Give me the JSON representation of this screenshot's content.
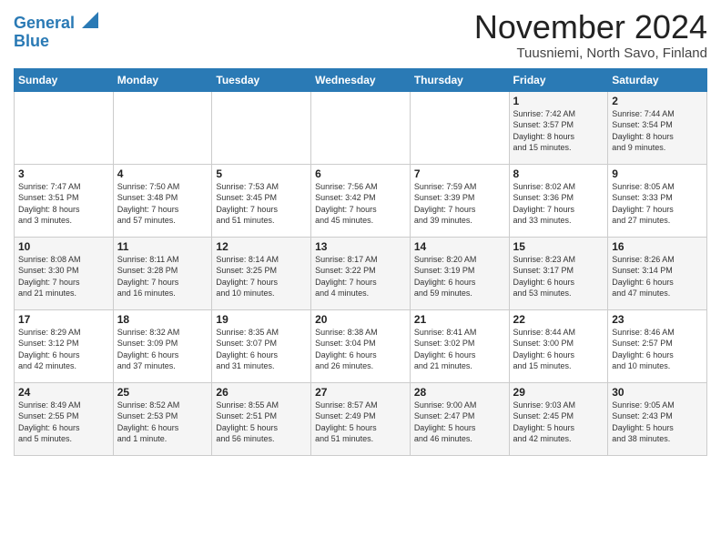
{
  "header": {
    "logo_line1": "General",
    "logo_line2": "Blue",
    "title": "November 2024",
    "subtitle": "Tuusniemi, North Savo, Finland"
  },
  "days_of_week": [
    "Sunday",
    "Monday",
    "Tuesday",
    "Wednesday",
    "Thursday",
    "Friday",
    "Saturday"
  ],
  "weeks": [
    [
      {
        "day": "",
        "info": ""
      },
      {
        "day": "",
        "info": ""
      },
      {
        "day": "",
        "info": ""
      },
      {
        "day": "",
        "info": ""
      },
      {
        "day": "",
        "info": ""
      },
      {
        "day": "1",
        "info": "Sunrise: 7:42 AM\nSunset: 3:57 PM\nDaylight: 8 hours\nand 15 minutes."
      },
      {
        "day": "2",
        "info": "Sunrise: 7:44 AM\nSunset: 3:54 PM\nDaylight: 8 hours\nand 9 minutes."
      }
    ],
    [
      {
        "day": "3",
        "info": "Sunrise: 7:47 AM\nSunset: 3:51 PM\nDaylight: 8 hours\nand 3 minutes."
      },
      {
        "day": "4",
        "info": "Sunrise: 7:50 AM\nSunset: 3:48 PM\nDaylight: 7 hours\nand 57 minutes."
      },
      {
        "day": "5",
        "info": "Sunrise: 7:53 AM\nSunset: 3:45 PM\nDaylight: 7 hours\nand 51 minutes."
      },
      {
        "day": "6",
        "info": "Sunrise: 7:56 AM\nSunset: 3:42 PM\nDaylight: 7 hours\nand 45 minutes."
      },
      {
        "day": "7",
        "info": "Sunrise: 7:59 AM\nSunset: 3:39 PM\nDaylight: 7 hours\nand 39 minutes."
      },
      {
        "day": "8",
        "info": "Sunrise: 8:02 AM\nSunset: 3:36 PM\nDaylight: 7 hours\nand 33 minutes."
      },
      {
        "day": "9",
        "info": "Sunrise: 8:05 AM\nSunset: 3:33 PM\nDaylight: 7 hours\nand 27 minutes."
      }
    ],
    [
      {
        "day": "10",
        "info": "Sunrise: 8:08 AM\nSunset: 3:30 PM\nDaylight: 7 hours\nand 21 minutes."
      },
      {
        "day": "11",
        "info": "Sunrise: 8:11 AM\nSunset: 3:28 PM\nDaylight: 7 hours\nand 16 minutes."
      },
      {
        "day": "12",
        "info": "Sunrise: 8:14 AM\nSunset: 3:25 PM\nDaylight: 7 hours\nand 10 minutes."
      },
      {
        "day": "13",
        "info": "Sunrise: 8:17 AM\nSunset: 3:22 PM\nDaylight: 7 hours\nand 4 minutes."
      },
      {
        "day": "14",
        "info": "Sunrise: 8:20 AM\nSunset: 3:19 PM\nDaylight: 6 hours\nand 59 minutes."
      },
      {
        "day": "15",
        "info": "Sunrise: 8:23 AM\nSunset: 3:17 PM\nDaylight: 6 hours\nand 53 minutes."
      },
      {
        "day": "16",
        "info": "Sunrise: 8:26 AM\nSunset: 3:14 PM\nDaylight: 6 hours\nand 47 minutes."
      }
    ],
    [
      {
        "day": "17",
        "info": "Sunrise: 8:29 AM\nSunset: 3:12 PM\nDaylight: 6 hours\nand 42 minutes."
      },
      {
        "day": "18",
        "info": "Sunrise: 8:32 AM\nSunset: 3:09 PM\nDaylight: 6 hours\nand 37 minutes."
      },
      {
        "day": "19",
        "info": "Sunrise: 8:35 AM\nSunset: 3:07 PM\nDaylight: 6 hours\nand 31 minutes."
      },
      {
        "day": "20",
        "info": "Sunrise: 8:38 AM\nSunset: 3:04 PM\nDaylight: 6 hours\nand 26 minutes."
      },
      {
        "day": "21",
        "info": "Sunrise: 8:41 AM\nSunset: 3:02 PM\nDaylight: 6 hours\nand 21 minutes."
      },
      {
        "day": "22",
        "info": "Sunrise: 8:44 AM\nSunset: 3:00 PM\nDaylight: 6 hours\nand 15 minutes."
      },
      {
        "day": "23",
        "info": "Sunrise: 8:46 AM\nSunset: 2:57 PM\nDaylight: 6 hours\nand 10 minutes."
      }
    ],
    [
      {
        "day": "24",
        "info": "Sunrise: 8:49 AM\nSunset: 2:55 PM\nDaylight: 6 hours\nand 5 minutes."
      },
      {
        "day": "25",
        "info": "Sunrise: 8:52 AM\nSunset: 2:53 PM\nDaylight: 6 hours\nand 1 minute."
      },
      {
        "day": "26",
        "info": "Sunrise: 8:55 AM\nSunset: 2:51 PM\nDaylight: 5 hours\nand 56 minutes."
      },
      {
        "day": "27",
        "info": "Sunrise: 8:57 AM\nSunset: 2:49 PM\nDaylight: 5 hours\nand 51 minutes."
      },
      {
        "day": "28",
        "info": "Sunrise: 9:00 AM\nSunset: 2:47 PM\nDaylight: 5 hours\nand 46 minutes."
      },
      {
        "day": "29",
        "info": "Sunrise: 9:03 AM\nSunset: 2:45 PM\nDaylight: 5 hours\nand 42 minutes."
      },
      {
        "day": "30",
        "info": "Sunrise: 9:05 AM\nSunset: 2:43 PM\nDaylight: 5 hours\nand 38 minutes."
      }
    ]
  ]
}
